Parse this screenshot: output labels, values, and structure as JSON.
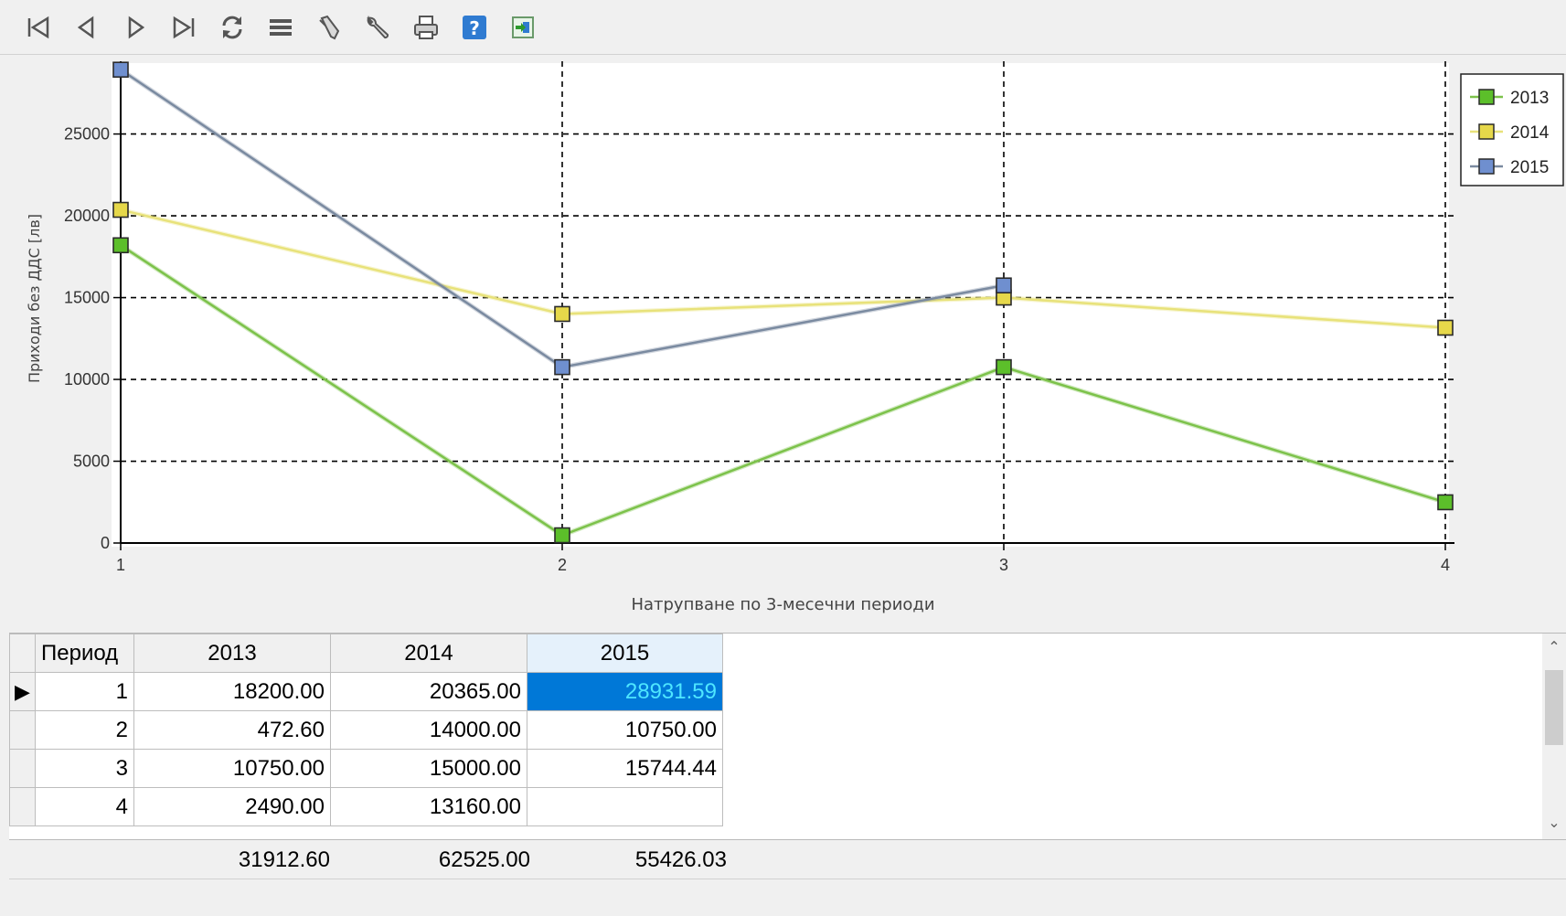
{
  "toolbar": {
    "buttons": [
      {
        "icon": "first-record-icon"
      },
      {
        "icon": "previous-record-icon"
      },
      {
        "icon": "next-record-icon"
      },
      {
        "icon": "last-record-icon"
      },
      {
        "icon": "refresh-icon"
      },
      {
        "icon": "list-icon"
      },
      {
        "icon": "pen-icon"
      },
      {
        "icon": "wrench-icon"
      },
      {
        "icon": "print-icon"
      },
      {
        "icon": "help-icon"
      },
      {
        "icon": "exit-icon"
      }
    ]
  },
  "chart_data": {
    "type": "line",
    "x": [
      1,
      2,
      3,
      4
    ],
    "xlabel": "Натрупване по 3-месечни периоди",
    "ylabel": "Приходи без ДДС [лв]",
    "ylim": [
      0,
      29000
    ],
    "yticks": [
      0,
      5000,
      10000,
      15000,
      20000,
      25000
    ],
    "xticks": [
      1,
      2,
      3,
      4
    ],
    "grid": true,
    "legend_position": "top-right",
    "series": [
      {
        "name": "2013",
        "color": "#5cbf2a",
        "line_color": "#7cc24a",
        "values": [
          18200.0,
          472.6,
          10750.0,
          2490.0
        ]
      },
      {
        "name": "2014",
        "color": "#e6d84a",
        "line_color": "#e8e27a",
        "values": [
          20365.0,
          14000.0,
          15000.0,
          13160.0
        ]
      },
      {
        "name": "2015",
        "color": "#6f8fcf",
        "line_color": "#7a8aa0",
        "values": [
          28931.59,
          10750.0,
          15744.44
        ]
      }
    ]
  },
  "grid": {
    "headers": [
      "Период",
      "2013",
      "2014",
      "2015"
    ],
    "rows": [
      [
        "1",
        "18200.00",
        "20365.00",
        "28931.59"
      ],
      [
        "2",
        "472.60",
        "14000.00",
        "10750.00"
      ],
      [
        "3",
        "10750.00",
        "15000.00",
        "15744.44"
      ],
      [
        "4",
        "2490.00",
        "13160.00",
        ""
      ]
    ],
    "current_row_marker": "▶"
  },
  "totals": {
    "y2013": "31912.60",
    "y2014": "62525.00",
    "y2015": "55426.03"
  }
}
